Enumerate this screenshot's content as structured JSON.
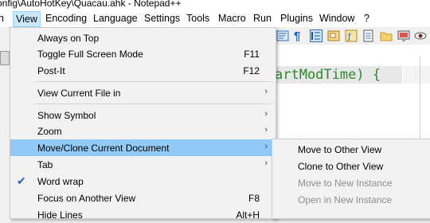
{
  "window": {
    "title": "onfig\\AutoHotKey\\Quacau.ahk - Notepad++"
  },
  "menubar": {
    "items": [
      "h",
      "View",
      "Encoding",
      "Language",
      "Settings",
      "Tools",
      "Macro",
      "Run",
      "Plugins",
      "Window",
      "?"
    ]
  },
  "editor": {
    "code_fragment": "artModTime) {"
  },
  "view_menu": {
    "items": [
      {
        "label": "Always on Top"
      },
      {
        "label": "Toggle Full Screen Mode",
        "shortcut": "F11"
      },
      {
        "label": "Post-It",
        "shortcut": "F12"
      },
      {
        "label": "View Current File in",
        "submenu": true
      },
      {
        "label": "Show Symbol",
        "submenu": true
      },
      {
        "label": "Zoom",
        "submenu": true
      },
      {
        "label": "Move/Clone Current Document",
        "submenu": true,
        "highlighted": true
      },
      {
        "label": "Tab",
        "submenu": true
      },
      {
        "label": "Word wrap",
        "checked": true
      },
      {
        "label": "Focus on Another View",
        "shortcut": "F8"
      },
      {
        "label": "Hide Lines",
        "shortcut": "Alt+H"
      }
    ]
  },
  "move_clone_submenu": {
    "items": [
      {
        "label": "Move to Other View",
        "enabled": true
      },
      {
        "label": "Clone to Other View",
        "enabled": true
      },
      {
        "label": "Move to New Instance",
        "enabled": false
      },
      {
        "label": "Open in New Instance",
        "enabled": false
      }
    ]
  },
  "icons": {
    "submenu_arrow": "chevron-right-icon",
    "check": "check-icon"
  },
  "colors": {
    "highlight": "#91c9f7",
    "menu_bg": "#f2f2f2",
    "code_green": "#2a8a2a",
    "check_blue": "#1a66c9"
  }
}
